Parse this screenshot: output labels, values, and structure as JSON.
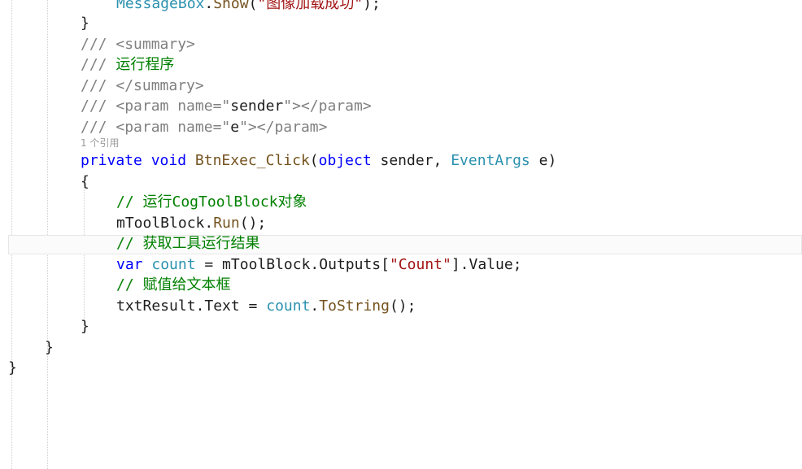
{
  "codelens": "1 个引用",
  "lines": [
    {
      "indent": 143,
      "tokens": [
        {
          "t": "MessageBox",
          "c": "ty"
        },
        {
          "t": ".",
          "c": "pl"
        },
        {
          "t": "Show",
          "c": "fn"
        },
        {
          "t": "(",
          "c": "pl"
        },
        {
          "t": "\"图像加载成功\"",
          "c": "str"
        },
        {
          "t": ");",
          "c": "pl"
        }
      ]
    },
    {
      "indent": 99,
      "tokens": [
        {
          "t": "}",
          "c": "pl"
        }
      ]
    },
    {
      "indent": 99,
      "tokens": [
        {
          "t": "/// ",
          "c": "xd"
        },
        {
          "t": "<summary>",
          "c": "xd"
        }
      ]
    },
    {
      "indent": 99,
      "tokens": [
        {
          "t": "/// ",
          "c": "xd"
        },
        {
          "t": "运行程序",
          "c": "cm"
        }
      ]
    },
    {
      "indent": 99,
      "tokens": [
        {
          "t": "/// ",
          "c": "xd"
        },
        {
          "t": "</summary>",
          "c": "xd"
        }
      ]
    },
    {
      "indent": 99,
      "tokens": [
        {
          "t": "/// ",
          "c": "xd"
        },
        {
          "t": "<param name=\"",
          "c": "xd"
        },
        {
          "t": "sender",
          "c": "pl"
        },
        {
          "t": "\"></param>",
          "c": "xd"
        }
      ]
    },
    {
      "indent": 99,
      "tokens": [
        {
          "t": "/// ",
          "c": "xd"
        },
        {
          "t": "<param name=\"",
          "c": "xd"
        },
        {
          "t": "e",
          "c": "pl"
        },
        {
          "t": "\"></param>",
          "c": "xd"
        }
      ]
    },
    {
      "indent": 99,
      "tokens": [
        {
          "t": "private",
          "c": "kw"
        },
        {
          "t": " ",
          "c": "pl"
        },
        {
          "t": "void",
          "c": "kw"
        },
        {
          "t": " ",
          "c": "pl"
        },
        {
          "t": "BtnExec_Click",
          "c": "fn"
        },
        {
          "t": "(",
          "c": "pl"
        },
        {
          "t": "object",
          "c": "kw"
        },
        {
          "t": " sender, ",
          "c": "pl"
        },
        {
          "t": "EventArgs",
          "c": "ty"
        },
        {
          "t": " e)",
          "c": "pl"
        }
      ]
    },
    {
      "indent": 99,
      "tokens": [
        {
          "t": "{",
          "c": "pl"
        }
      ]
    },
    {
      "indent": 143,
      "tokens": [
        {
          "t": "// 运行CogToolBlock对象",
          "c": "cm"
        }
      ]
    },
    {
      "indent": 143,
      "tokens": [
        {
          "t": "mToolBlock.",
          "c": "pl"
        },
        {
          "t": "Run",
          "c": "fn"
        },
        {
          "t": "();",
          "c": "pl"
        }
      ]
    },
    {
      "indent": 143,
      "tokens": [
        {
          "t": "// 获取工具运行结果",
          "c": "cm"
        }
      ]
    },
    {
      "indent": 143,
      "tokens": [
        {
          "t": "var",
          "c": "kw"
        },
        {
          "t": " ",
          "c": "pl"
        },
        {
          "t": "count",
          "c": "ty"
        },
        {
          "t": " = mToolBlock.Outputs[",
          "c": "pl"
        },
        {
          "t": "\"Count\"",
          "c": "str"
        },
        {
          "t": "].Value;",
          "c": "pl"
        }
      ]
    },
    {
      "indent": 143,
      "tokens": [
        {
          "t": "// 赋值给文本框",
          "c": "cm"
        }
      ]
    },
    {
      "indent": 143,
      "tokens": [
        {
          "t": "txtResult.Text = ",
          "c": "pl"
        },
        {
          "t": "count",
          "c": "ty"
        },
        {
          "t": ".",
          "c": "pl"
        },
        {
          "t": "ToString",
          "c": "fn"
        },
        {
          "t": "();",
          "c": "pl"
        }
      ]
    },
    {
      "indent": 99,
      "tokens": [
        {
          "t": "}",
          "c": "pl"
        }
      ]
    },
    {
      "indent": 55,
      "tokens": [
        {
          "t": "}",
          "c": "pl"
        }
      ]
    },
    {
      "indent": 10,
      "tokens": [
        {
          "t": "}",
          "c": "pl"
        }
      ]
    }
  ]
}
